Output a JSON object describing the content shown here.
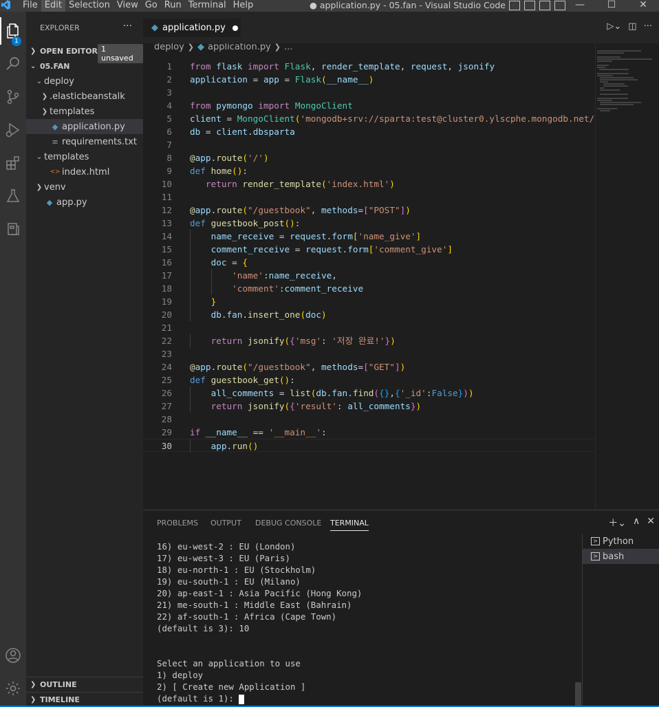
{
  "menu": [
    "File",
    "Edit",
    "Selection",
    "View",
    "Go",
    "Run",
    "Terminal",
    "Help"
  ],
  "window_title": "● application.py - 05.fan - Visual Studio Code",
  "window_controls": {
    "minimize": "—",
    "maximize": "☐",
    "close": "✕"
  },
  "activity_badge": "1",
  "explorer": {
    "title": "EXPLORER",
    "more": "···",
    "open_editors": "OPEN EDITORS",
    "unsaved": "1 unsaved",
    "root": "05.FAN",
    "items": [
      {
        "label": "deploy",
        "type": "folder-open",
        "indent": 1
      },
      {
        "label": ".elasticbeanstalk",
        "type": "folder",
        "indent": 2
      },
      {
        "label": "templates",
        "type": "folder",
        "indent": 2
      },
      {
        "label": "application.py",
        "type": "python",
        "indent": 2,
        "selected": true
      },
      {
        "label": "requirements.txt",
        "type": "text",
        "indent": 2
      },
      {
        "label": "templates",
        "type": "folder-open",
        "indent": 1
      },
      {
        "label": "index.html",
        "type": "html",
        "indent": 2
      },
      {
        "label": "venv",
        "type": "folder",
        "indent": 1
      },
      {
        "label": "app.py",
        "type": "python",
        "indent": 1
      }
    ],
    "outline": "OUTLINE",
    "timeline": "TIMELINE"
  },
  "editor": {
    "tab_label": "application.py",
    "breadcrumb": [
      "deploy",
      "application.py",
      "..."
    ],
    "current_line": 30,
    "code_lines": [
      "from flask import Flask, render_template, request, jsonify",
      "application = app = Flask(__name__)",
      "",
      "from pymongo import MongoClient",
      "client = MongoClient('mongodb+srv://sparta:test@cluster0.ylscphe.mongodb.net/",
      "db = client.dbsparta",
      "",
      "@app.route('/')",
      "def home():",
      "   return render_template('index.html')",
      "",
      "@app.route(\"/guestbook\", methods=[\"POST\"])",
      "def guestbook_post():",
      "    name_receive = request.form['name_give']",
      "    comment_receive = request.form['comment_give']",
      "    doc = {",
      "        'name':name_receive,",
      "        'comment':comment_receive",
      "    }",
      "    db.fan.insert_one(doc)",
      "",
      "    return jsonify({'msg': '저장 완료!'})",
      "",
      "@app.route(\"/guestbook\", methods=[\"GET\"])",
      "def guestbook_get():",
      "    all_comments = list(db.fan.find({},{'_id':False}))",
      "    return jsonify({'result': all_comments})",
      "",
      "if __name__ == '__main__':",
      "    app.run()"
    ]
  },
  "panel": {
    "tabs": [
      "PROBLEMS",
      "OUTPUT",
      "DEBUG CONSOLE",
      "TERMINAL"
    ],
    "active_tab": "TERMINAL",
    "terminal_lines": [
      "16) eu-west-2 : EU (London)",
      "17) eu-west-3 : EU (Paris)",
      "18) eu-north-1 : EU (Stockholm)",
      "19) eu-south-1 : EU (Milano)",
      "20) ap-east-1 : Asia Pacific (Hong Kong)",
      "21) me-south-1 : Middle East (Bahrain)",
      "22) af-south-1 : Africa (Cape Town)",
      "(default is 3): 10",
      "",
      "",
      "Select an application to use",
      "1) deploy",
      "2) [ Create new Application ]",
      "(default is 1): "
    ],
    "terminals": [
      {
        "label": "Python",
        "selected": false
      },
      {
        "label": "bash",
        "selected": true
      }
    ]
  }
}
